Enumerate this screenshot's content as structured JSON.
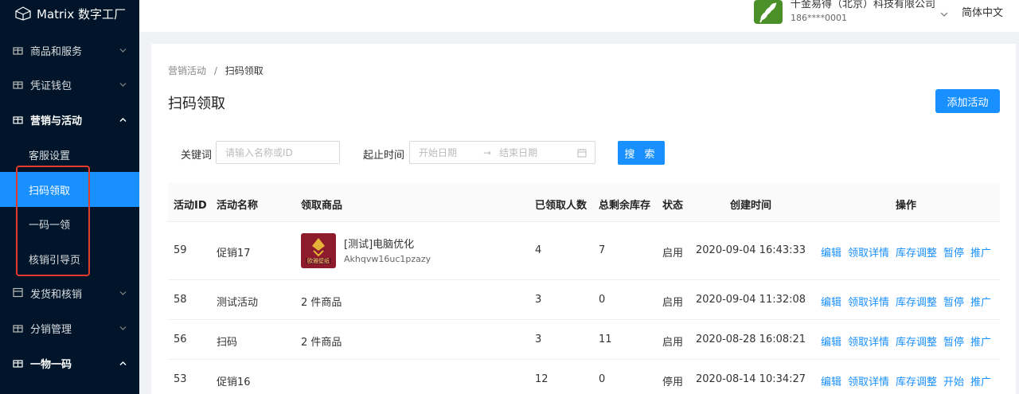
{
  "app": {
    "name": "Matrix 数字工厂"
  },
  "sidebar": {
    "items": [
      {
        "label": "商品和服务",
        "open": false
      },
      {
        "label": "凭证钱包",
        "open": false
      },
      {
        "label": "营销与活动",
        "open": true
      },
      {
        "label": "发货和核销",
        "open": false
      },
      {
        "label": "分销管理",
        "open": false
      },
      {
        "label": "一物一码",
        "open": true
      }
    ],
    "subitems": [
      "客服设置",
      "扫码领取",
      "一码一领",
      "核销引导页"
    ],
    "active_subitem": "扫码领取"
  },
  "header": {
    "company_name": "千金易得（北京）科技有限公司",
    "company_phone": "186****0001",
    "language": "简体中文"
  },
  "breadcrumb": {
    "parent": "营销活动",
    "separator": "/",
    "current": "扫码领取"
  },
  "page_title": "扫码领取",
  "add_button": "添加活动",
  "filters": {
    "keyword_label": "关键词",
    "keyword_placeholder": "请输入名称或ID",
    "time_label": "起止时间",
    "start_placeholder": "开始日期",
    "arrow": "→",
    "end_placeholder": "结束日期",
    "search_button": "搜 索"
  },
  "table": {
    "columns": [
      "活动ID",
      "活动名称",
      "领取商品",
      "已领取人数",
      "总剩余库存",
      "状态",
      "创建时间",
      "操作"
    ],
    "rows": [
      {
        "id": "59",
        "name": "促销17",
        "product_title": "[测试]电脑优化",
        "product_code": "Akhqvw16uc1pzazy",
        "product_thumb_text": "欧雅壁纸",
        "claimed": "4",
        "stock": "7",
        "status": "启用",
        "created": "2020-09-04 16:43:33",
        "actions": [
          "编辑",
          "领取详情",
          "库存调整",
          "暂停",
          "推广"
        ]
      },
      {
        "id": "58",
        "name": "测试活动",
        "product_title": "2 件商品",
        "claimed": "3",
        "stock": "0",
        "status": "启用",
        "created": "2020-09-04 11:32:08",
        "actions": [
          "编辑",
          "领取详情",
          "库存调整",
          "暂停",
          "推广"
        ]
      },
      {
        "id": "56",
        "name": "扫码",
        "product_title": "2 件商品",
        "claimed": "3",
        "stock": "11",
        "status": "启用",
        "created": "2020-08-28 16:08:21",
        "actions": [
          "编辑",
          "领取详情",
          "库存调整",
          "暂停",
          "推广"
        ]
      },
      {
        "id": "53",
        "name": "促销16",
        "product_title": "",
        "claimed": "12",
        "stock": "0",
        "status": "停用",
        "created": "2020-08-14 10:34:27",
        "actions": [
          "编辑",
          "领取详情",
          "库存调整",
          "开始",
          "推广"
        ]
      }
    ]
  },
  "colors": {
    "sidebar_bg": "#001529",
    "primary": "#1890ff",
    "highlight_box": "#e23b2e"
  }
}
